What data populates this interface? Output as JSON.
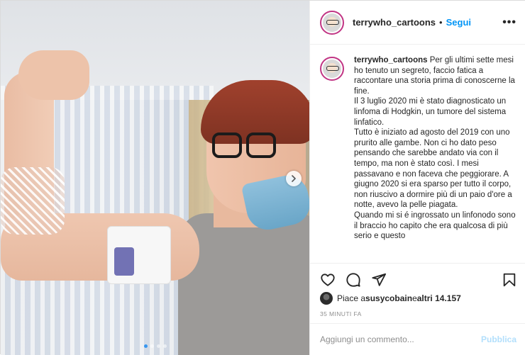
{
  "header": {
    "username": "terrywho_cartoons",
    "separator": "•",
    "follow_label": "Segui",
    "more_label": "•••"
  },
  "caption": {
    "username": "terrywho_cartoons",
    "text": "Per gli ultimi sette mesi ho tenuto un segreto, faccio fatica a raccontare una storia prima di conoscerne la fine.\nIl 3 luglio 2020 mi è stato diagnosticato un linfoma di Hodgkin, un tumore del sistema linfatico.\nTutto è iniziato ad agosto del 2019 con uno prurito alle gambe. Non ci ho dato peso pensando che sarebbe andato via con il tempo, ma non è stato così. I mesi passavano e non faceva che peggiorare. A giugno 2020 si era sparso per tutto il corpo, non riuscivo a dormire più di un paio d'ore a notte, avevo la pelle piagata.\nQuando mi si é ingrossato un linfonodo sono il braccio ho capito che era qualcosa di più serio e questo"
  },
  "actions": {
    "icons": [
      "heart-icon",
      "comment-icon",
      "share-icon",
      "bookmark-icon"
    ]
  },
  "likes": {
    "prefix": "Piace a ",
    "user": "susycobain",
    "middle": " e ",
    "others": "altri 14.157"
  },
  "timestamp": "35 MINUTI FA",
  "comment": {
    "placeholder": "Aggiungi un commento...",
    "publish_label": "Pubblica"
  },
  "carousel": {
    "slide_count": 4,
    "active_index": 0
  },
  "colors": {
    "follow": "#0095f6",
    "publish_disabled": "#b2dffc",
    "active_dot": "#3897f0"
  }
}
